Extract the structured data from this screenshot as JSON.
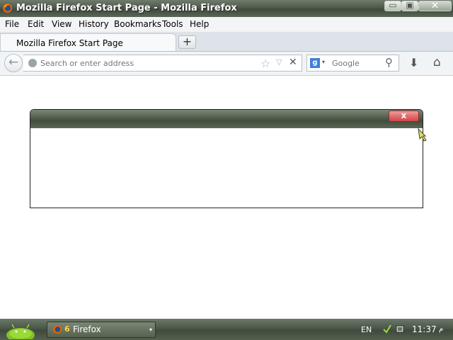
{
  "window": {
    "title": "Mozilla Firefox Start Page - Mozilla Firefox",
    "close_glyph": "✕",
    "minimize_glyph": "▭",
    "maximize_glyph": "▣"
  },
  "menu": {
    "items": [
      "File",
      "Edit",
      "View",
      "History",
      "Bookmarks",
      "Tools",
      "Help"
    ]
  },
  "tabs": {
    "active_label": "Mozilla Firefox Start Page",
    "new_tab_glyph": "+"
  },
  "nav": {
    "back_glyph": "←",
    "address_placeholder": "Search or enter address",
    "address_value": "",
    "star_glyph": "☆",
    "dropdown_glyph": "▽",
    "stop_glyph": "✕",
    "search_engine_letter": "g",
    "search_dropdown_glyph": "▾",
    "search_placeholder": "Google",
    "search_go_glyph": "⚲",
    "download_glyph": "⬇",
    "home_glyph": "⌂"
  },
  "dialog": {
    "close_glyph": "x"
  },
  "taskbar": {
    "task_label": "Firefox",
    "task_count": "6",
    "task_arrow": "▾",
    "language": "EN",
    "clock": "11:37",
    "clock_suffix": "م"
  },
  "colors": {
    "titlebar": "#4e5a4b",
    "dialog_close": "#d04545",
    "tab_strip": "#dde3e8",
    "nav_bar": "#f1f4f6"
  }
}
